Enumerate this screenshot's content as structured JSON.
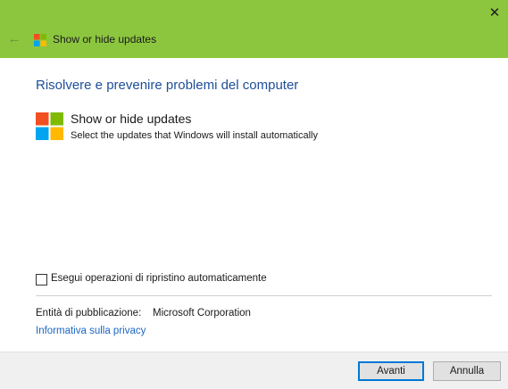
{
  "window": {
    "title": "Show or hide updates",
    "close_glyph": "✕",
    "back_glyph": "←"
  },
  "colors": {
    "titlebar": "#8cc63f",
    "heading": "#1e4e98",
    "link": "#1a66c2",
    "logo_red": "#f25022",
    "logo_green": "#7fba00",
    "logo_blue": "#00a4ef",
    "logo_yellow": "#ffb900"
  },
  "main": {
    "heading": "Risolvere e prevenire problemi del computer",
    "app_title": "Show or hide updates",
    "app_description": "Select the updates that Windows will install automatically",
    "checkbox_label": "Esegui operazioni di ripristino automaticamente",
    "checkbox_checked": false,
    "publisher_label": "Entità di pubblicazione:",
    "publisher_value": "Microsoft Corporation",
    "privacy_link": "Informativa sulla privacy"
  },
  "footer": {
    "next_label": "Avanti",
    "cancel_label": "Annulla"
  },
  "icons": {
    "back": "back-arrow-icon",
    "close": "close-icon",
    "logo": "windows-logo-icon"
  }
}
